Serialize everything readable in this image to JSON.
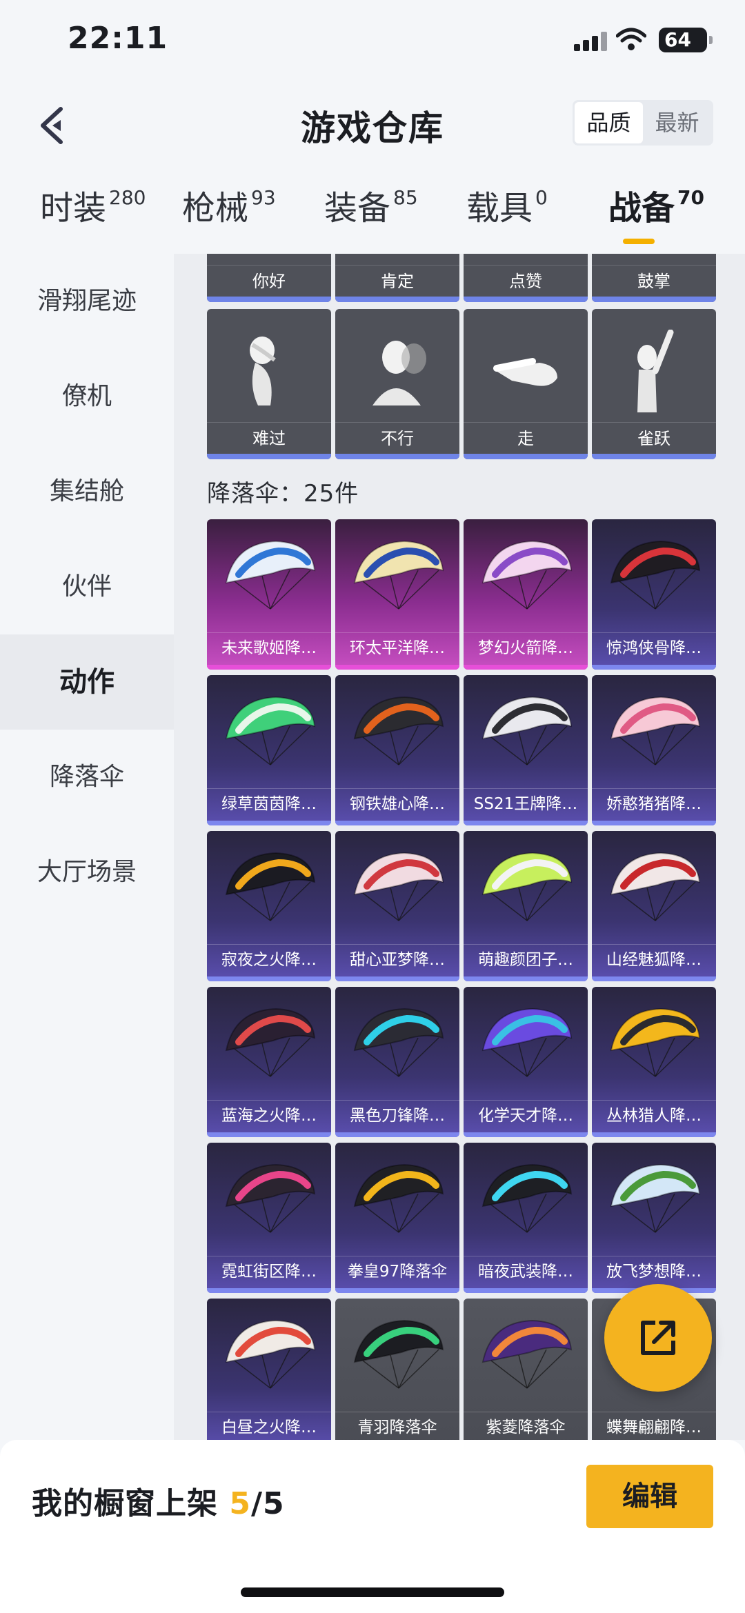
{
  "status": {
    "time": "22:11",
    "battery": "64"
  },
  "header": {
    "title": "游戏仓库",
    "sort_quality": "品质",
    "sort_newest": "最新"
  },
  "tabs": [
    {
      "label": "时装",
      "count": "280"
    },
    {
      "label": "枪械",
      "count": "93"
    },
    {
      "label": "装备",
      "count": "85"
    },
    {
      "label": "载具",
      "count": "0"
    },
    {
      "label": "战备",
      "count": "70"
    }
  ],
  "sidebar": [
    {
      "label": "滑翔尾迹"
    },
    {
      "label": "僚机"
    },
    {
      "label": "集结舱"
    },
    {
      "label": "伙伴"
    },
    {
      "label": "动作"
    },
    {
      "label": "降落伞"
    },
    {
      "label": "大厅场景"
    }
  ],
  "emotes_row1": [
    "你好",
    "肯定",
    "点赞",
    "鼓掌"
  ],
  "emotes_row2": [
    "难过",
    "不行",
    "走",
    "雀跃"
  ],
  "section": {
    "title": "降落伞：25件"
  },
  "parachutes": [
    "未来歌姬降…",
    "环太平洋降…",
    "梦幻火箭降…",
    "惊鸿侠骨降…",
    "绿草茵茵降…",
    "钢铁雄心降…",
    "SS21王牌降…",
    "娇憨猪猪降…",
    "寂夜之火降…",
    "甜心亚梦降…",
    "萌趣颜团子…",
    "山经魅狐降…",
    "蓝海之火降…",
    "黑色刀锋降…",
    "化学天才降…",
    "丛林猎人降…",
    "霓虹街区降…",
    "拳皇97降落伞",
    "暗夜武装降…",
    "放飞梦想降…",
    "白昼之火降…",
    "青羽降落伞",
    "紫菱降落伞",
    "蝶舞翩翩降…"
  ],
  "parachute_colors": [
    [
      "#e8f0fa",
      "#2f77d6"
    ],
    [
      "#f1e4b0",
      "#2a4fb0"
    ],
    [
      "#f3d6ef",
      "#8a4bc7"
    ],
    [
      "#1f1c22",
      "#d8343a"
    ],
    [
      "#3fd07a",
      "#e8f6ea"
    ],
    [
      "#2b2b30",
      "#e2621d"
    ],
    [
      "#e9e9ee",
      "#2d2d33"
    ],
    [
      "#f7c9d6",
      "#e05a84"
    ],
    [
      "#1b1b22",
      "#f0a81c"
    ],
    [
      "#f1dbe1",
      "#d0383f"
    ],
    [
      "#c7ef5d",
      "#f3f3f5"
    ],
    [
      "#f1e7e7",
      "#c8282c"
    ],
    [
      "#2a2032",
      "#e04a4a"
    ],
    [
      "#2b2b34",
      "#2fd0e8"
    ],
    [
      "#6a4be0",
      "#3ac0e4"
    ],
    [
      "#f3b71c",
      "#2b2b2f"
    ],
    [
      "#2b2430",
      "#e8458a"
    ],
    [
      "#202024",
      "#f2b51b"
    ],
    [
      "#1e1f24",
      "#3fd6f0"
    ],
    [
      "#d3e7f7",
      "#4a9a3a"
    ],
    [
      "#f0ebe6",
      "#e24b3c"
    ],
    [
      "#1c1d22",
      "#38d07d"
    ],
    [
      "#4a2b7e",
      "#f1873a"
    ],
    [
      "#6a6a70",
      "#d8d8dc"
    ]
  ],
  "showcase": {
    "label": "我的橱窗上架",
    "current": "5",
    "total": "/5"
  },
  "edit_button": "编辑",
  "colors": {
    "accent": "#f4b31f",
    "epic": "#7d87ee",
    "legendary": "#e64fd8"
  }
}
